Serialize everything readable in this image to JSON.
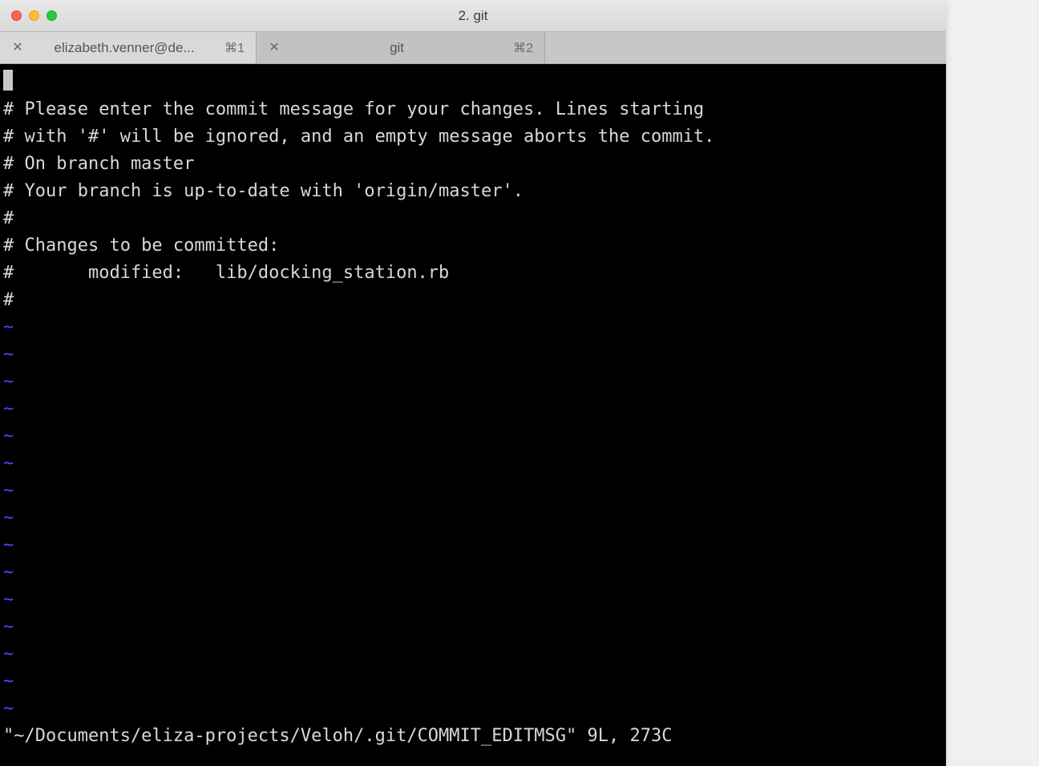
{
  "window": {
    "title": "2. git"
  },
  "tabs": [
    {
      "label": "elizabeth.venner@de...",
      "shortcut": "⌘1",
      "active": false
    },
    {
      "label": "git",
      "shortcut": "⌘2",
      "active": true
    }
  ],
  "editor": {
    "lines": [
      "",
      "# Please enter the commit message for your changes. Lines starting",
      "# with '#' will be ignored, and an empty message aborts the commit.",
      "# On branch master",
      "# Your branch is up-to-date with 'origin/master'.",
      "#",
      "# Changes to be committed:",
      "#       modified:   lib/docking_station.rb",
      "#"
    ],
    "tilde": "~",
    "tilde_count": 15,
    "statusline": "\"~/Documents/eliza-projects/Veloh/.git/COMMIT_EDITMSG\" 9L, 273C"
  }
}
